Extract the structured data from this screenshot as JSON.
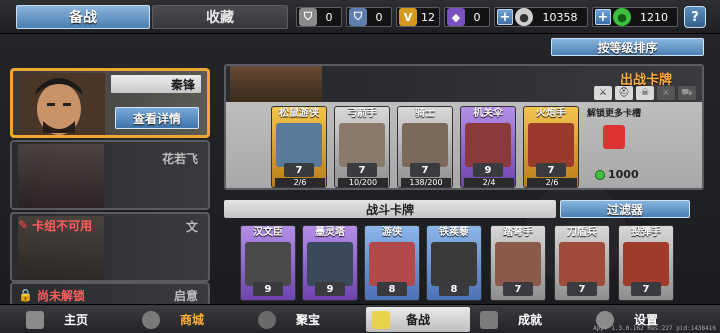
{
  "tabs": {
    "active": "备战",
    "inactive": "收藏"
  },
  "currencies": [
    {
      "icon": "shield-icon",
      "value": "0",
      "color": "#d9d9d9"
    },
    {
      "icon": "shield-blue-icon",
      "value": "0",
      "color": "#9bb7e0"
    },
    {
      "icon": "gold-medal-icon",
      "value": "12",
      "color": "#e8b52f"
    },
    {
      "icon": "purple-badge-icon",
      "value": "0",
      "color": "#9a6fd8"
    }
  ],
  "coins": {
    "value": "10358",
    "icon": "silver-coin-icon"
  },
  "gems": {
    "value": "1210",
    "icon": "green-gem-icon"
  },
  "help_label": "?",
  "sort_label": "按等级排序",
  "commanders": [
    {
      "name": "秦锋",
      "detail_label": "查看详情",
      "state": "selected"
    },
    {
      "name": "花若飞",
      "state": "normal"
    },
    {
      "name": "文",
      "lock_label": "卡组不可用",
      "state": "unavailable"
    },
    {
      "name": "启意",
      "lock_label": "尚未解锁",
      "state": "locked"
    }
  ],
  "deck": {
    "title": "出战卡牌",
    "unlock_label": "解锁更多卡槽",
    "unlock_cost": "1000",
    "cards": [
      {
        "name": "松鼠游侠",
        "cost": "7",
        "progress": "2/6",
        "rarity": "r-gold"
      },
      {
        "name": "弓箭手",
        "cost": "7",
        "progress": "10/200",
        "rarity": "r-grey"
      },
      {
        "name": "骑士",
        "cost": "7",
        "progress": "138/200",
        "rarity": "r-grey"
      },
      {
        "name": "机关伞",
        "cost": "9",
        "progress": "2/4",
        "rarity": "r-purple"
      },
      {
        "name": "火炮手",
        "cost": "7",
        "progress": "2/6",
        "rarity": "r-gold"
      }
    ]
  },
  "battle_cards_title": "战斗卡牌",
  "filter_label": "过滤器",
  "battle_cards": [
    {
      "name": "汉文臣",
      "cost": "9",
      "rarity": "r-purple"
    },
    {
      "name": "墨灵塔",
      "cost": "9",
      "rarity": "r-purple"
    },
    {
      "name": "游侠",
      "cost": "8",
      "rarity": "r-blue"
    },
    {
      "name": "铁蒺藜",
      "cost": "8",
      "rarity": "r-blue"
    },
    {
      "name": "踏弩手",
      "cost": "7",
      "rarity": "r-grey"
    },
    {
      "name": "刀盾兵",
      "cost": "7",
      "rarity": "r-grey"
    },
    {
      "name": "投弹手",
      "cost": "7",
      "rarity": "r-grey"
    }
  ],
  "nav": [
    {
      "label": "主页",
      "icon": "home-icon",
      "state": "normal"
    },
    {
      "label": "商城",
      "icon": "shop-icon",
      "state": "highlight"
    },
    {
      "label": "聚宝",
      "icon": "treasure-icon",
      "state": "normal"
    },
    {
      "label": "备战",
      "icon": "cards-icon",
      "state": "active"
    },
    {
      "label": "成就",
      "icon": "achievement-icon",
      "state": "normal"
    },
    {
      "label": "设置",
      "icon": "gear-icon",
      "state": "normal"
    }
  ],
  "version": "App: 1.3.0.162 Res:227 pid:1438416"
}
